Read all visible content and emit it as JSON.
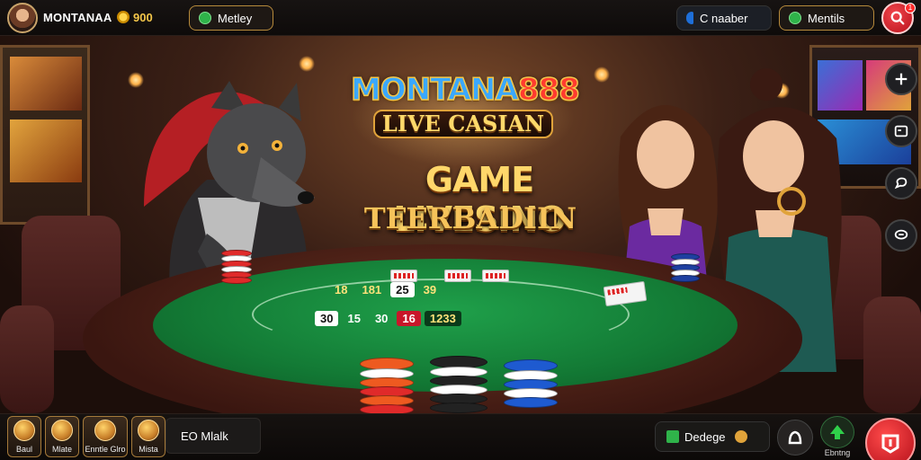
{
  "header": {
    "username": "MONTANAA",
    "coins": "900",
    "money_label": "Metley",
    "number_label": "C naaber",
    "menu_label": "Mentils",
    "notification_count": "1"
  },
  "hero": {
    "logo_main_text": "MONTANA",
    "logo_main_number": "888",
    "logo_sub": "LIVE CASIAN",
    "headline": "GAME LIVESINO",
    "subhead": "TFERBADIIN"
  },
  "table": {
    "bet_row_top": [
      "18",
      "181",
      "25",
      "39"
    ],
    "bet_row_bottom": [
      "30",
      "15",
      "30",
      "16",
      "1233"
    ]
  },
  "bottom": {
    "games": [
      {
        "label": "Baul"
      },
      {
        "label": "Mlate"
      },
      {
        "label": "Enntle Glro"
      },
      {
        "label": "Mista"
      }
    ],
    "panel_text": "EO Mlalk",
    "dealer_label": "Dedege",
    "bonus_label": "Ebntng"
  },
  "colors": {
    "accent_gold": "#f3c64a",
    "felt_green": "#1fa04a",
    "action_red": "#d8151f"
  }
}
